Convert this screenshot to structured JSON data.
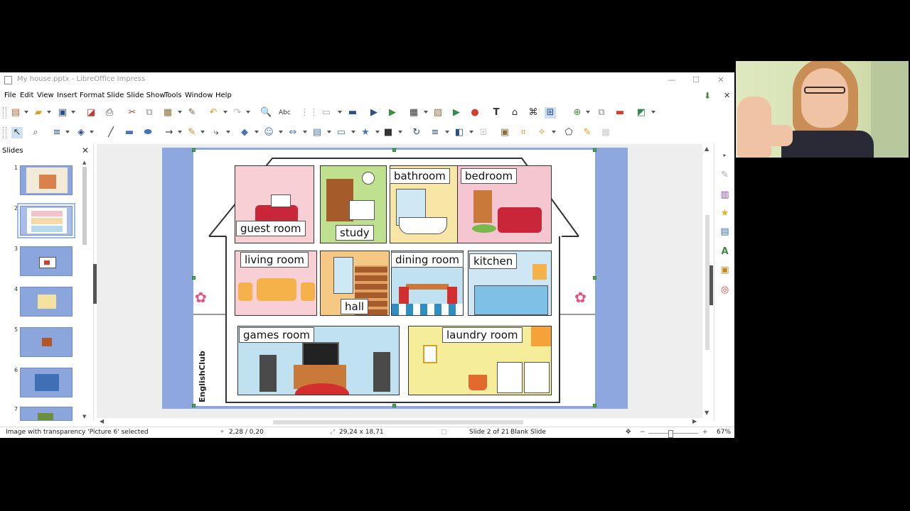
{
  "window": {
    "title": "My house.pptx - LibreOffice Impress",
    "controls": {
      "minimize": "—",
      "maximize": "☐",
      "close": "✕"
    }
  },
  "menu": [
    "File",
    "Edit",
    "View",
    "Insert",
    "Format",
    "Slide",
    "Slide Show",
    "Tools",
    "Window",
    "Help"
  ],
  "slides_panel": {
    "header": "Slides",
    "thumbnails": [
      "1",
      "2",
      "3",
      "4",
      "5",
      "6",
      "7"
    ],
    "selected": "2"
  },
  "slide_image": {
    "rooms": {
      "guest_room": "guest room",
      "study": "study",
      "bathroom": "bathroom",
      "bedroom": "bedroom",
      "living_room": "living room",
      "hall": "hall",
      "dining_room": "dining room",
      "kitchen": "kitchen",
      "games_room": "games room",
      "laundry_room": "laundry room"
    },
    "brand": "EnglishClub"
  },
  "statusbar": {
    "selection": "Image with transparency 'Picture 6' selected",
    "position": "2,28 / 0,20",
    "size": "29,24 x 18,71",
    "slide_info": "Slide 2 of 21",
    "layout": "Blank Slide",
    "zoom_minus": "−",
    "zoom_plus": "+",
    "zoom": "67%"
  },
  "colors": {
    "slide_bg": "#8ea8df",
    "selection_handle": "#4caf50",
    "workspace": "#eeeeee"
  }
}
